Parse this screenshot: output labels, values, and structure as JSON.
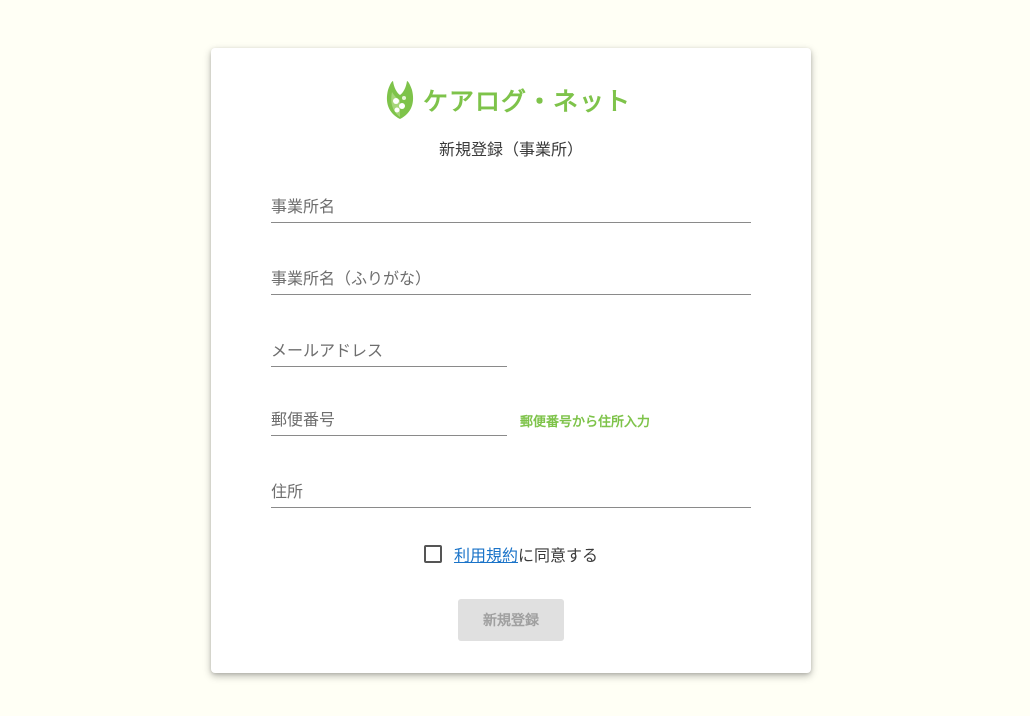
{
  "brand": {
    "name": "ケアログ・ネット",
    "logo_icon": "leaf-logo-icon",
    "color": "#7ec34a"
  },
  "page": {
    "subtitle": "新規登録（事業所）"
  },
  "form": {
    "office_name": {
      "placeholder": "事業所名",
      "value": ""
    },
    "office_name_kana": {
      "placeholder": "事業所名（ふりがな）",
      "value": ""
    },
    "email": {
      "placeholder": "メールアドレス",
      "value": ""
    },
    "postal_code": {
      "placeholder": "郵便番号",
      "value": ""
    },
    "postal_lookup_label": "郵便番号から住所入力",
    "address": {
      "placeholder": "住所",
      "value": ""
    },
    "terms": {
      "checked": false,
      "link_text": "利用規約",
      "suffix": "に同意する",
      "link_color": "#1a73c8"
    },
    "submit_label": "新規登録",
    "submit_disabled": true
  }
}
